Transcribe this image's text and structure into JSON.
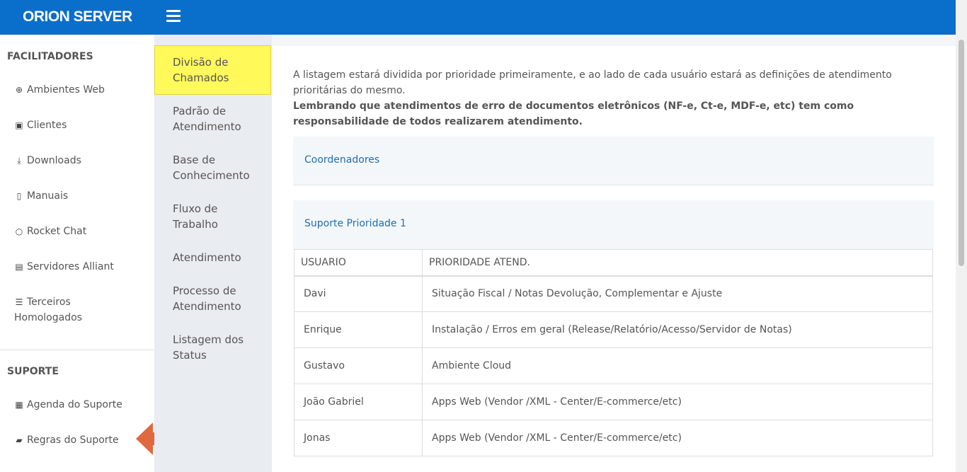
{
  "header": {
    "logo": "ORION SERVER"
  },
  "sidebar": {
    "section1_title": "FACILITADORES",
    "items": [
      {
        "label": "Ambientes Web",
        "icon": "globe-icon",
        "glyph": "⊕"
      },
      {
        "label": "Clientes",
        "icon": "contact-card-icon",
        "glyph": "▣"
      },
      {
        "label": "Downloads",
        "icon": "download-icon",
        "glyph": "⤓"
      },
      {
        "label": "Manuais",
        "icon": "book-icon",
        "glyph": "▯"
      },
      {
        "label": "Rocket Chat",
        "icon": "chat-bubble-icon",
        "glyph": "○"
      },
      {
        "label": "Servidores Alliant",
        "icon": "server-icon",
        "glyph": "▤"
      },
      {
        "label": "Terceiros Homologados",
        "icon": "list-icon",
        "glyph": "☰"
      }
    ],
    "section2_title": "SUPORTE",
    "support_items": [
      {
        "label": "Agenda do Suporte",
        "icon": "calendar-icon",
        "glyph": "▦"
      },
      {
        "label": "Regras do Suporte",
        "icon": "image-icon",
        "glyph": "▰"
      }
    ]
  },
  "subnav": {
    "items": [
      {
        "label": "Divisão de Chamados",
        "active": true
      },
      {
        "label": "Padrão de Atendimento"
      },
      {
        "label": "Base de Conhecimento"
      },
      {
        "label": "Fluxo de Trabalho"
      },
      {
        "label": "Atendimento"
      },
      {
        "label": "Processo de Atendimento"
      },
      {
        "label": "Listagem dos Status"
      }
    ],
    "active_color": "#fff95a"
  },
  "main": {
    "intro_text": "A listagem estará dividida por prioridade primeiramente, e ao lado de cada usuário estará as definições de atendimento prioritárias do mesmo.",
    "intro_bold": "Lembrando que atendimentos de erro de documentos eletrônicos (NF-e, Ct-e, MDF-e, etc) tem como responsabilidade de todos realizarem atendimento.",
    "cards": {
      "coordinators": "Coordenadores",
      "support_priority_1": "Suporte Prioridade 1"
    },
    "table": {
      "headers": [
        "USUARIO",
        "PRIORIDADE ATEND."
      ],
      "rows": [
        [
          "Davi",
          "Situação Fiscal / Notas Devolução, Complementar e Ajuste"
        ],
        [
          "Enrique",
          "Instalação / Erros em geral (Release/Relatório/Acesso/Servidor de Notas)"
        ],
        [
          "Gustavo",
          "Ambiente Cloud"
        ],
        [
          "João Gabriel",
          "Apps Web (Vendor /XML - Center/E-commerce/etc)"
        ],
        [
          "Jonas",
          "Apps Web (Vendor /XML - Center/E-commerce/etc)"
        ]
      ]
    }
  },
  "colors": {
    "brand": "#0a6ecb",
    "link": "#1f6eae",
    "arrow": "#e0693f"
  }
}
